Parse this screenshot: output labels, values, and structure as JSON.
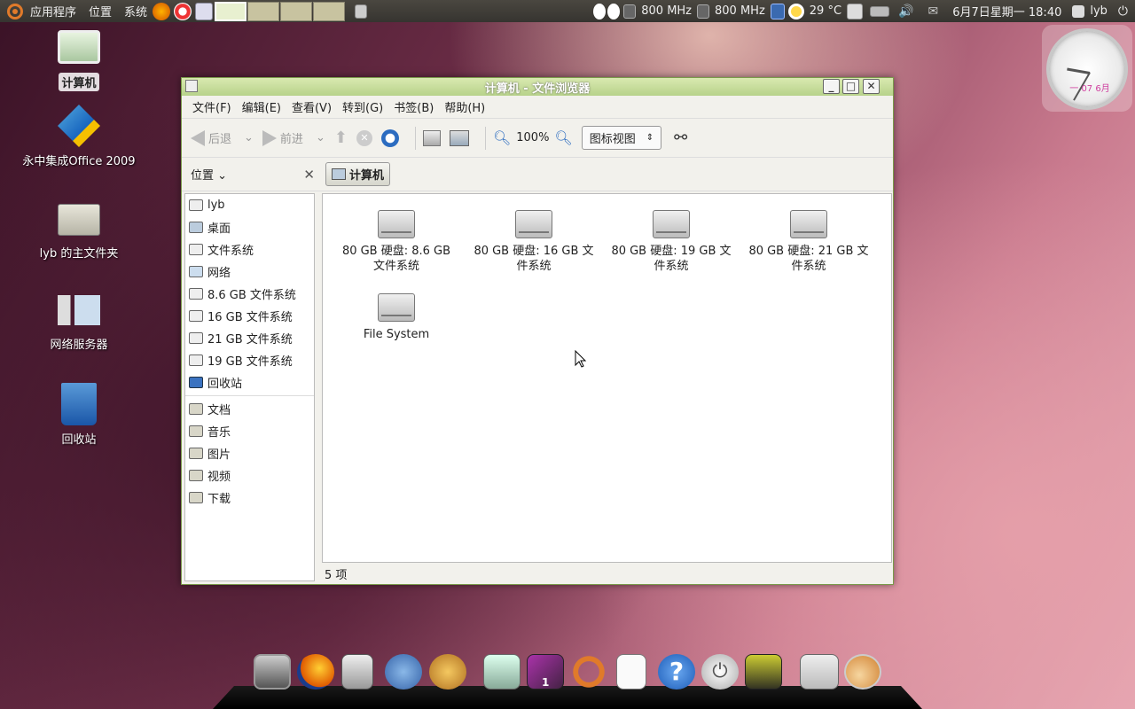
{
  "top_panel": {
    "menus": [
      "应用程序",
      "位置",
      "系统"
    ],
    "cpu1": "800 MHz",
    "cpu2": "800 MHz",
    "weather": "29 °C",
    "datetime": "6月7日星期一 18:40",
    "user": "lyb"
  },
  "desktop": {
    "icons": [
      {
        "label": "计算机",
        "icon": "computer-icon"
      },
      {
        "label": "永中集成Office 2009",
        "icon": "office-icon"
      },
      {
        "label": "lyb 的主文件夹",
        "icon": "home-folder-icon"
      },
      {
        "label": "网络服务器",
        "icon": "network-servers-icon"
      },
      {
        "label": "回收站",
        "icon": "trash-icon"
      }
    ]
  },
  "clock": {
    "date_text": "一 07 6月"
  },
  "window": {
    "title": "计算机 - 文件浏览器",
    "menus": [
      "文件(F)",
      "编辑(E)",
      "查看(V)",
      "转到(G)",
      "书签(B)",
      "帮助(H)"
    ],
    "toolbar": {
      "back": "后退",
      "forward": "前进",
      "zoom": "100%",
      "view_mode": "图标视图"
    },
    "places_label": "位置",
    "breadcrumb": "计算机",
    "sidebar": {
      "group1": [
        "lyb",
        "桌面",
        "文件系统",
        "网络",
        "8.6 GB 文件系统",
        "16 GB 文件系统",
        "21 GB 文件系统",
        "19 GB 文件系统",
        "回收站"
      ],
      "group2": [
        "文档",
        "音乐",
        "图片",
        "视频",
        "下载"
      ]
    },
    "items": [
      {
        "line1": "80 GB 硬盘: 8.6 GB",
        "line2": "文件系统"
      },
      {
        "line1": "80 GB 硬盘: 16 GB 文",
        "line2": "件系统"
      },
      {
        "line1": "80 GB 硬盘: 19 GB 文",
        "line2": "件系统"
      },
      {
        "line1": "80 GB 硬盘: 21 GB 文",
        "line2": "件系统"
      },
      {
        "line1": "File System",
        "line2": ""
      }
    ],
    "status": "5 项"
  },
  "dock": {
    "icons": [
      "terminal-icon",
      "firefox-icon",
      "calculator-icon",
      "pidgin-icon",
      "gimp-icon",
      "screenshot-icon",
      "workspace-switcher-icon",
      "ubuntu-icon",
      "text-editor-icon",
      "help-icon",
      "shutdown-icon",
      "image-viewer-icon",
      "firefox-window-icon",
      "nautilus-icon"
    ],
    "workspace_badge": "1"
  }
}
